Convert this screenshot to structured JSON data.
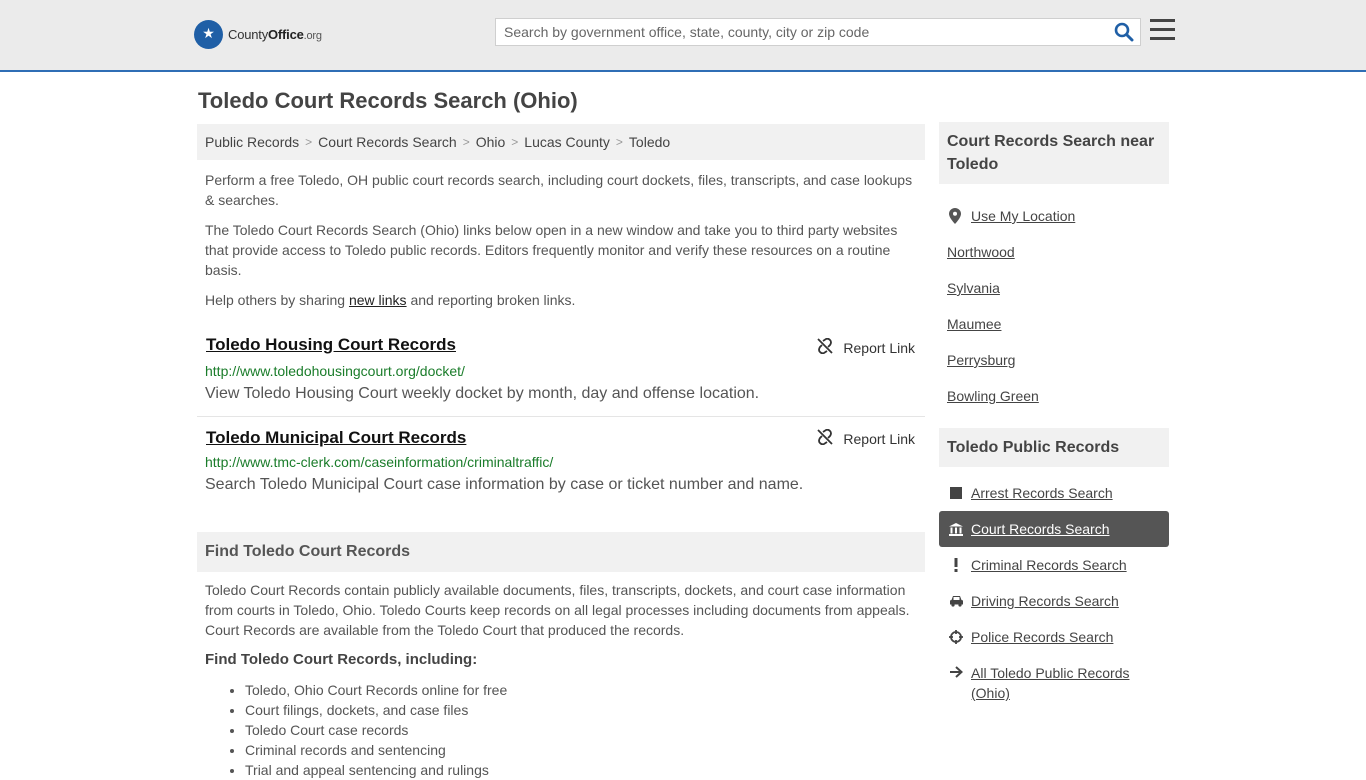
{
  "header": {
    "logo_main": "County",
    "logo_bold": "Office",
    "logo_tld": ".org",
    "search_placeholder": "Search by government office, state, county, city or zip code"
  },
  "page_title": "Toledo Court Records Search (Ohio)",
  "breadcrumb": [
    "Public Records",
    "Court Records Search",
    "Ohio",
    "Lucas County",
    "Toledo"
  ],
  "intro": {
    "p1": "Perform a free Toledo, OH public court records search, including court dockets, files, transcripts, and case lookups & searches.",
    "p2": "The Toledo Court Records Search (Ohio) links below open in a new window and take you to third party websites that provide access to Toledo public records. Editors frequently monitor and verify these resources on a routine basis.",
    "p3_before": "Help others by sharing ",
    "p3_link": "new links",
    "p3_after": " and reporting broken links."
  },
  "results": [
    {
      "title": "Toledo Housing Court Records",
      "url": "http://www.toledohousingcourt.org/docket/",
      "description": "View Toledo Housing Court weekly docket by month, day and offense location.",
      "report": "Report Link"
    },
    {
      "title": "Toledo Municipal Court Records",
      "url": "http://www.tmc-clerk.com/caseinformation/criminaltraffic/",
      "description": "Search Toledo Municipal Court case information by case or ticket number and name.",
      "report": "Report Link"
    }
  ],
  "find": {
    "heading": "Find Toledo Court Records",
    "body": "Toledo Court Records contain publicly available documents, files, transcripts, dockets, and court case information from courts in Toledo, Ohio. Toledo Courts keep records on all legal processes including documents from appeals. Court Records are available from the Toledo Court that produced the records.",
    "subheading": "Find Toledo Court Records, including:",
    "items": [
      "Toledo, Ohio Court Records online for free",
      "Court filings, dockets, and case files",
      "Toledo Court case records",
      "Criminal records and sentencing",
      "Trial and appeal sentencing and rulings"
    ]
  },
  "sidebar_near": {
    "title": "Court Records Search near Toledo",
    "use_location": "Use My Location",
    "places": [
      "Northwood",
      "Sylvania",
      "Maumee",
      "Perrysburg",
      "Bowling Green"
    ]
  },
  "sidebar_public": {
    "title": "Toledo Public Records",
    "items": [
      {
        "label": "Arrest Records Search",
        "icon": "square-icon"
      },
      {
        "label": "Court Records Search",
        "icon": "courthouse-icon"
      },
      {
        "label": "Criminal Records Search",
        "icon": "exclamation-icon"
      },
      {
        "label": "Driving Records Search",
        "icon": "car-icon"
      },
      {
        "label": "Police Records Search",
        "icon": "crosshair-icon"
      },
      {
        "label": "All Toledo Public Records (Ohio)",
        "icon": "arrow-right-icon"
      }
    ]
  },
  "colors": {
    "brand_blue": "#2f6eb5",
    "link_green": "#1a7c2a",
    "active_bg": "#555555"
  }
}
